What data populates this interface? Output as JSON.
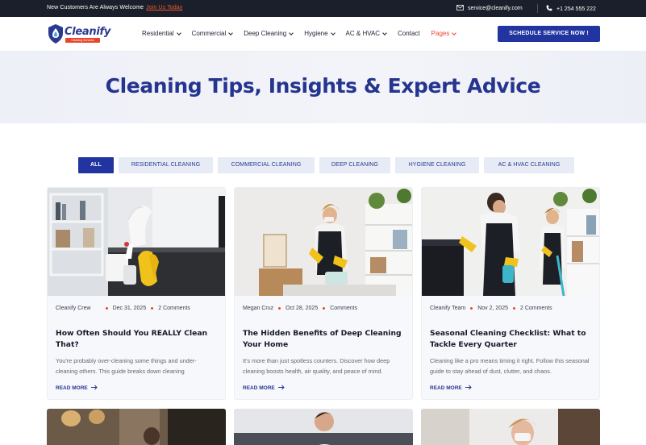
{
  "topbar": {
    "welcome": "New Customers Are Always Welcome",
    "welcome_link": "Join Us Today",
    "email": "service@cleanify.com",
    "phone": "+1 254 555 222"
  },
  "logo": {
    "name": "Cleanify",
    "tagline": "Cleaning Services"
  },
  "nav": {
    "items": [
      {
        "label": "Residential",
        "dropdown": true
      },
      {
        "label": "Commercial",
        "dropdown": true
      },
      {
        "label": "Deep Cleaning",
        "dropdown": true
      },
      {
        "label": "Hygiene",
        "dropdown": true
      },
      {
        "label": "AC & HVAC",
        "dropdown": true
      },
      {
        "label": "Contact",
        "dropdown": false
      },
      {
        "label": "Pages",
        "dropdown": true,
        "active": true
      }
    ],
    "cta": "SCHEDULE SERVICE NOW !"
  },
  "hero": {
    "title": "Cleaning Tips, Insights & Expert Advice"
  },
  "filters": [
    {
      "label": "ALL",
      "active": true
    },
    {
      "label": "RESIDENTIAL CLEANING"
    },
    {
      "label": "COMMERCIAL CLEANING"
    },
    {
      "label": "DEEP CLEANING"
    },
    {
      "label": "HYGIENE CLEANING"
    },
    {
      "label": "AC & HVAC  CLEANING"
    }
  ],
  "posts": [
    {
      "author": "Cleanify Crew",
      "date": "Dec 31, 2025",
      "comments": "2 Comments",
      "title": "How Often Should You REALLY Clean That?",
      "excerpt": "You're probably over-cleaning some things and under-cleaning others. This guide breaks down cleaning",
      "more": "READ MORE"
    },
    {
      "author": "Megan Cruz",
      "date": "Oct 28, 2025",
      "comments": "Comments",
      "title": "The Hidden Benefits of Deep Cleaning Your Home",
      "excerpt": "It's more than just spotless counters. Discover how deep cleaning boosts health, air quality, and peace of mind.",
      "more": "READ MORE"
    },
    {
      "author": "Cleanify Team",
      "date": "Nov 2, 2025",
      "comments": "2 Comments",
      "title": "Seasonal Cleaning Checklist: What to Tackle Every Quarter",
      "excerpt": "Cleaning like a pro means timing it right. Follow this seasonal guide to stay ahead of dust, clutter, and chaos.",
      "more": "READ MORE"
    }
  ],
  "colors": {
    "brand": "#2234a0",
    "accent": "#e8452c",
    "dark": "#1b1f2b"
  }
}
